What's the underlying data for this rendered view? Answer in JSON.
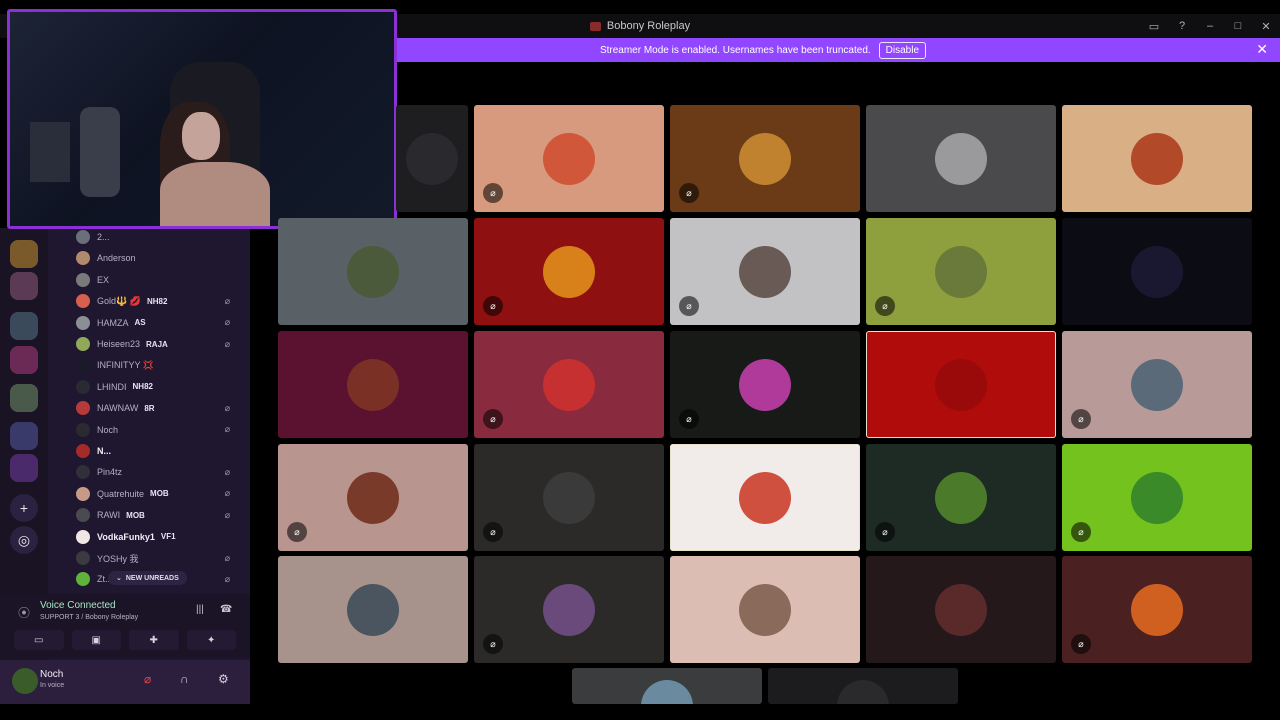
{
  "window": {
    "title": "Bobony Roleplay",
    "controls": [
      "inbox-icon",
      "help-icon",
      "minimize-icon",
      "maximize-icon",
      "close-icon"
    ]
  },
  "banner": {
    "text": "Streamer Mode is enabled. Usernames have been truncated.",
    "button_label": "Disable"
  },
  "members": [
    {
      "name": "2...",
      "tag": "",
      "color": "#6b6f7a",
      "muted": false
    },
    {
      "name": "Anderson",
      "tag": "",
      "color": "#b08a6a",
      "muted": false
    },
    {
      "name": "EX",
      "tag": "",
      "color": "#7a7a7a",
      "muted": false
    },
    {
      "name": "Gold🔱 💋",
      "tag": "NH82",
      "color": "#d6604d",
      "muted": true
    },
    {
      "name": "HAMZA",
      "tag": "AS",
      "color": "#8a8f96",
      "muted": true
    },
    {
      "name": "Heiseen23",
      "tag": "RAJA",
      "color": "#8fa85a",
      "muted": true
    },
    {
      "name": "INFINITYY 💢",
      "tag": "",
      "color": "#1a1a2a",
      "muted": false
    },
    {
      "name": "LHINDI",
      "tag": "NH82",
      "color": "#2a2a35",
      "muted": false
    },
    {
      "name": "NAWNAW",
      "tag": "8R",
      "color": "#b73a3a",
      "muted": true
    },
    {
      "name": "Noch",
      "tag": "",
      "color": "#2a2a30",
      "muted": true
    },
    {
      "name": "N...",
      "tag": "",
      "color": "#a52a2a",
      "muted": false
    },
    {
      "name": "Pin4tz",
      "tag": "",
      "color": "#30303a",
      "muted": true
    },
    {
      "name": "Quatrehuite",
      "tag": "MOB",
      "color": "#c79a88",
      "muted": true
    },
    {
      "name": "RAWI",
      "tag": "MOB",
      "color": "#4a4a50",
      "muted": true
    },
    {
      "name": "VodkaFunky1",
      "tag": "VF1",
      "color": "#f0e6e6",
      "muted": false
    },
    {
      "name": "YOSHy 我",
      "tag": "",
      "color": "#3a3a40",
      "muted": true
    },
    {
      "name": "Zt...",
      "tag": "",
      "color": "#5fb33a",
      "muted": true
    }
  ],
  "new_unreads_label": "NEW UNREADS",
  "voice": {
    "title": "Voice Connected",
    "channel": "SUPPORT 3 / Bobony Roleplay"
  },
  "user": {
    "name": "Noch",
    "status": "In voice"
  },
  "tiles": [
    {
      "bg": "#1e1e20",
      "avatar": "#2a2a2e",
      "muted": false,
      "speaking": false
    },
    {
      "bg": "#d89a7e",
      "avatar": "#d0573a",
      "muted": true,
      "speaking": false
    },
    {
      "bg": "#6b3a16",
      "avatar": "#c0822e",
      "muted": true,
      "speaking": false
    },
    {
      "bg": "#4a4a4c",
      "avatar": "#9a9a9c",
      "muted": false,
      "speaking": false
    },
    {
      "bg": "#d9b085",
      "avatar": "#b24a2a",
      "muted": false,
      "speaking": false
    },
    {
      "bg": "#596066",
      "avatar": "#4a5a3a",
      "muted": false,
      "speaking": false
    },
    {
      "bg": "#8f1010",
      "avatar": "#d8801a",
      "muted": true,
      "speaking": false
    },
    {
      "bg": "#c2c2c4",
      "avatar": "#6a5a55",
      "muted": true,
      "speaking": false
    },
    {
      "bg": "#8ea03e",
      "avatar": "#6a7a3a",
      "muted": true,
      "speaking": false
    },
    {
      "bg": "#0c0c14",
      "avatar": "#1a1830",
      "muted": false,
      "speaking": false
    },
    {
      "bg": "#5a1230",
      "avatar": "#7a3025",
      "muted": false,
      "speaking": false
    },
    {
      "bg": "#8a2a3e",
      "avatar": "#c63030",
      "muted": true,
      "speaking": false
    },
    {
      "bg": "#181a18",
      "avatar": "#b03a9a",
      "muted": true,
      "speaking": false
    },
    {
      "bg": "#b00c0c",
      "avatar": "#9a0a0a",
      "muted": false,
      "speaking": true
    },
    {
      "bg": "#b89a98",
      "avatar": "#5a6a78",
      "muted": true,
      "speaking": false
    },
    {
      "bg": "#b8968f",
      "avatar": "#7a3a2a",
      "muted": true,
      "speaking": false
    },
    {
      "bg": "#2c2a28",
      "avatar": "#3a3a3a",
      "muted": true,
      "speaking": false
    },
    {
      "bg": "#f1ebea",
      "avatar": "#d05040",
      "muted": false,
      "speaking": true
    },
    {
      "bg": "#1e2a24",
      "avatar": "#4a7a2a",
      "muted": true,
      "speaking": false
    },
    {
      "bg": "#74c21e",
      "avatar": "#3a8a2a",
      "muted": true,
      "speaking": false
    },
    {
      "bg": "#a8938c",
      "avatar": "#4a5560",
      "muted": false,
      "speaking": false
    },
    {
      "bg": "#2c2a28",
      "avatar": "#6a4a7a",
      "muted": true,
      "speaking": false
    },
    {
      "bg": "#dcbdb3",
      "avatar": "#8a6a5a",
      "muted": false,
      "speaking": false
    },
    {
      "bg": "#24181a",
      "avatar": "#5a2a2a",
      "muted": false,
      "speaking": false
    },
    {
      "bg": "#4a2020",
      "avatar": "#d06020",
      "muted": true,
      "speaking": false
    },
    {
      "bg": "#3a3c3e",
      "avatar": "#6a8aa0",
      "muted": false,
      "speaking": false
    },
    {
      "bg": "#1c1c1e",
      "avatar": "#2a2a2c",
      "muted": false,
      "speaking": false
    }
  ]
}
